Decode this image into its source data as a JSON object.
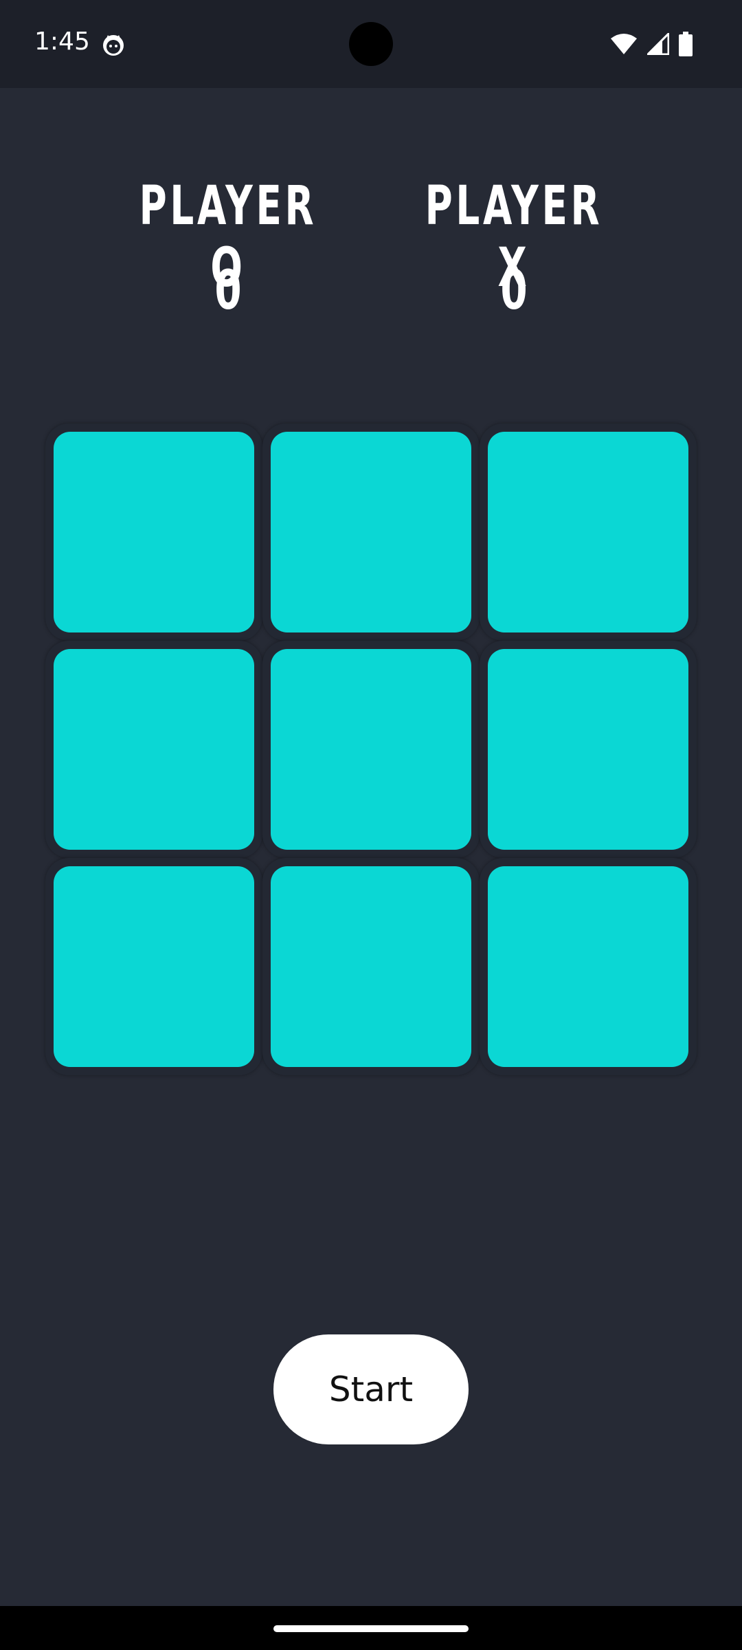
{
  "status_bar": {
    "time": "1:45",
    "app_icon": "cat-face-icon",
    "wifi_icon": "wifi-icon",
    "signal_icon": "cellular-signal-icon",
    "battery_icon": "battery-icon"
  },
  "scoreboard": {
    "player_o": {
      "label": "PLAYER O",
      "score": "0"
    },
    "player_x": {
      "label": "PLAYER X",
      "score": "0"
    }
  },
  "board": {
    "cells": [
      "",
      "",
      "",
      "",
      "",
      "",
      "",
      "",
      ""
    ],
    "cell_color": "#0bd7d4",
    "frame_color": "#232833"
  },
  "controls": {
    "start_label": "Start"
  },
  "colors": {
    "background": "#262a35",
    "status_bar": "#1d2029",
    "accent": "#0bd7d4"
  }
}
